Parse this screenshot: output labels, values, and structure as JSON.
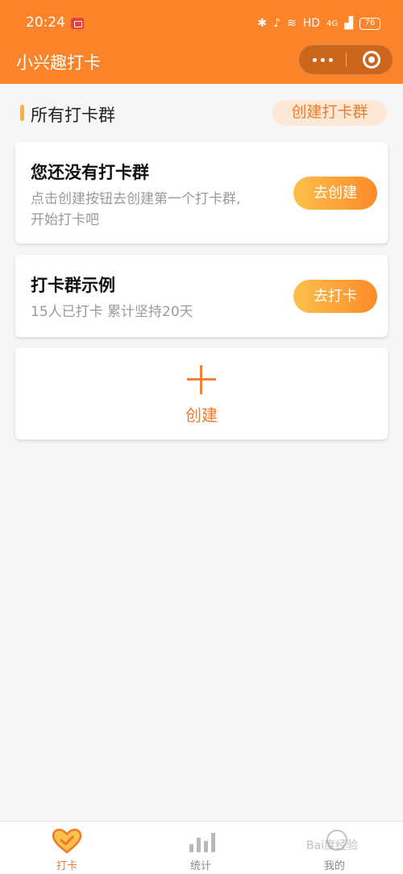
{
  "status_bar": {
    "time": "20:24",
    "network": "HD",
    "signal": "4G",
    "battery": "76"
  },
  "header": {
    "title": "小兴趣打卡"
  },
  "section": {
    "title": "所有打卡群",
    "create_button": "创建打卡群"
  },
  "empty_card": {
    "title": "您还没有打卡群",
    "desc_line1": "点击创建按钮去创建第一个打卡群,",
    "desc_line2": "开始打卡吧",
    "button": "去创建"
  },
  "example_card": {
    "title": "打卡群示例",
    "desc": "15人已打卡 累计坚持20天",
    "button": "去打卡"
  },
  "create_card": {
    "label": "创建"
  },
  "tabbar": {
    "tabs": [
      {
        "label": "打卡",
        "icon": "heart-check-icon",
        "active": true
      },
      {
        "label": "统计",
        "icon": "bar-chart-icon",
        "active": false
      },
      {
        "label": "我的",
        "icon": "user-icon",
        "active": false
      }
    ]
  },
  "colors": {
    "header": "#fb8329",
    "accent": "#f07a2a",
    "button_gradient_start": "#fcc04a",
    "button_gradient_end": "#fb8b2b"
  },
  "watermark": "Bai度经验"
}
